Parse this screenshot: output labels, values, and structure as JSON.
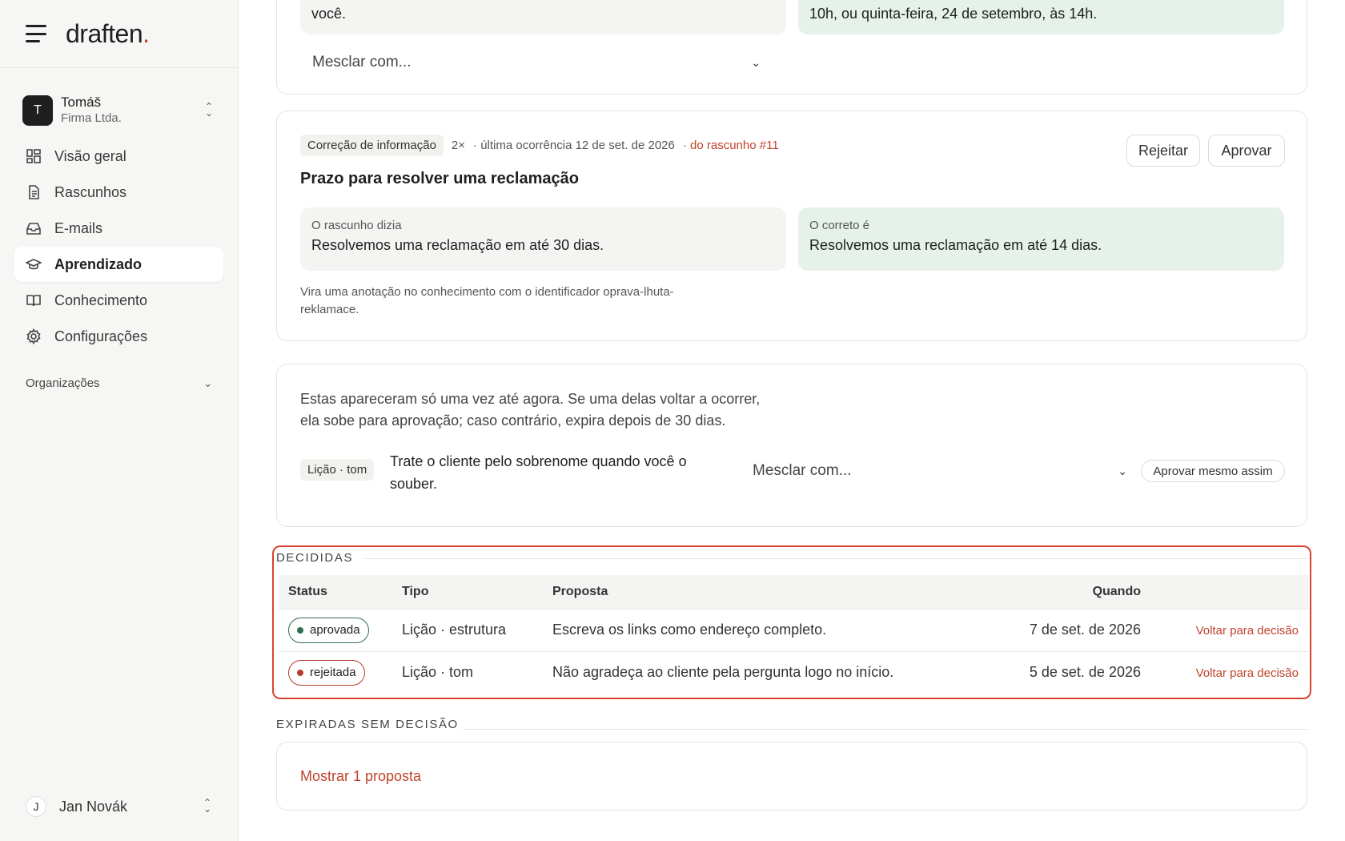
{
  "brand": {
    "name": "draften",
    "dot": "."
  },
  "account": {
    "initial": "T",
    "name": "Tomáš",
    "company": "Firma Ltda."
  },
  "nav": [
    {
      "label": "Visão geral",
      "icon": "grid-icon",
      "active": false
    },
    {
      "label": "Rascunhos",
      "icon": "document-icon",
      "active": false
    },
    {
      "label": "E-mails",
      "icon": "inbox-icon",
      "active": false
    },
    {
      "label": "Aprendizado",
      "icon": "graduation-cap-icon",
      "active": true
    },
    {
      "label": "Conhecimento",
      "icon": "book-icon",
      "active": false
    },
    {
      "label": "Configurações",
      "icon": "gear-icon",
      "active": false
    }
  ],
  "organizations_label": "Organizações",
  "user": {
    "initial": "J",
    "name": "Jan Novák"
  },
  "card_top": {
    "left_text": "você.",
    "right_text": "10h, ou quinta-feira, 24 de setembro, às 14h.",
    "merge_placeholder": "Mesclar com..."
  },
  "card_correction": {
    "tag": "Correção de informação",
    "count": "2×",
    "last_occurrence": "· última ocorrência 12 de set. de 2026",
    "draft_link": "· do rascunho #11",
    "reject_label": "Rejeitar",
    "approve_label": "Aprovar",
    "title": "Prazo para resolver uma reclamação",
    "was_label": "O rascunho dizia",
    "was_text": "Resolvemos uma reclamação em até 30 dias.",
    "correct_label": "O correto é",
    "correct_text": "Resolvemos uma reclamação em até 14 dias.",
    "note_line1": "Vira uma anotação no conhecimento com o identificador oprava-lhuta-",
    "note_line2": "reklamace."
  },
  "card_once": {
    "intro_line1": "Estas apareceram só uma vez até agora. Se uma delas voltar a ocorrer,",
    "intro_line2": "ela sobe para aprovação; caso contrário, expira depois de 30 dias.",
    "tag": "Lição · tom",
    "text_line1": "Trate o cliente pelo sobrenome quando você o",
    "text_line2": "souber.",
    "merge_placeholder": "Mesclar com...",
    "approve_anyway": "Aprovar mesmo assim"
  },
  "decided": {
    "section_label": "DECIDIDAS",
    "columns": {
      "status": "Status",
      "type": "Tipo",
      "proposal": "Proposta",
      "when": "Quando"
    },
    "rows": [
      {
        "status": "aprovada",
        "type": "Lição · estrutura",
        "proposal": "Escreva os links como endereço completo.",
        "when": "7 de set. de 2026",
        "action": "Voltar para decisão"
      },
      {
        "status": "rejeitada",
        "type": "Lição · tom",
        "proposal": "Não agradeça ao cliente pela pergunta logo no início.",
        "when": "5 de set. de 2026",
        "action": "Voltar para decisão"
      }
    ]
  },
  "expired": {
    "section_label": "EXPIRADAS SEM DECISÃO",
    "show_link": "Mostrar 1 proposta"
  },
  "colors": {
    "accent": "#c0432b",
    "approved": "#2f6e4f",
    "rejected": "#b33d2b",
    "highlight": "#d9442f"
  }
}
